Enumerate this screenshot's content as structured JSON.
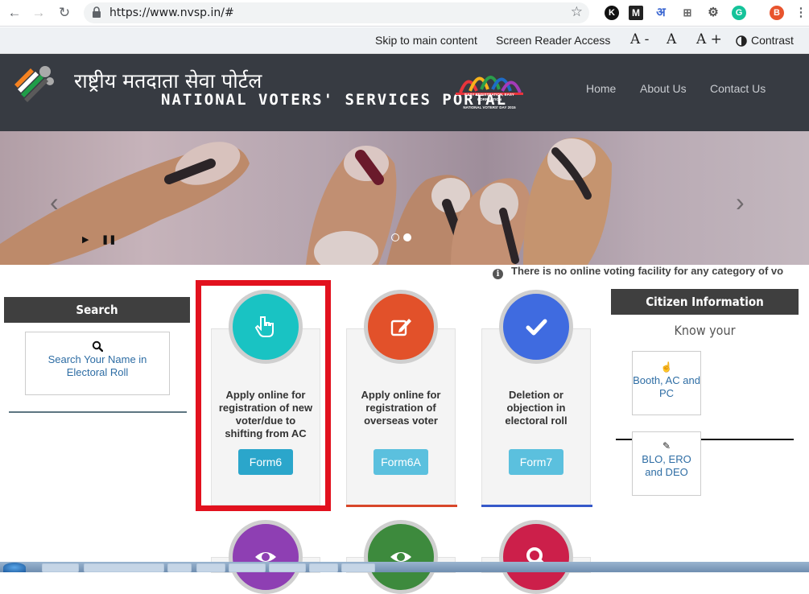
{
  "browser": {
    "url": "https://www.nvsp.in/#",
    "profile_initial": "B",
    "ext_initial": "K"
  },
  "access": {
    "skip": "Skip to main content",
    "reader": "Screen Reader Access",
    "a_minus": "A -",
    "a": "A",
    "a_plus": "A +",
    "contrast": "Contrast"
  },
  "header": {
    "title_hindi": "राष्ट्रीय मतदाता सेवा पोर्टल",
    "title_english": "NATIONAL VOTERS' SERVICES PORTAL",
    "nvd_line1": "EASY REGISTRATION, EASY CORRECTION",
    "nvd_line2": "NATIONAL VOTERS' DAY 2015",
    "nav": [
      "Home",
      "About Us",
      "Contact Us"
    ]
  },
  "ticker": "There is no online voting facility for any category of vo",
  "search": {
    "heading": "Search",
    "link": "Search Your Name in Electoral Roll"
  },
  "forms": [
    {
      "text": "Apply online for registration of new voter/due to shifting from AC",
      "button": "Form6",
      "color": "#19c3c3",
      "btn_color": "#2ba6cb",
      "line": "#f4f4f4"
    },
    {
      "text": "Apply online for registration of overseas voter",
      "button": "Form6A",
      "color": "#e2512a",
      "btn_color": "#5bc0de",
      "line": "#d8472a"
    },
    {
      "text": "Deletion or objection in electoral roll",
      "button": "Form7",
      "color": "#3f6be0",
      "btn_color": "#5bc0de",
      "line": "#3659c9"
    }
  ],
  "lower_icons": [
    "#8e3fb3",
    "#3d8a3d",
    "#cc1f4a"
  ],
  "citizen": {
    "heading": "Citizen Information",
    "subheading": "Know your",
    "items": [
      "Booth, AC and PC",
      "BLO, ERO and DEO"
    ]
  }
}
